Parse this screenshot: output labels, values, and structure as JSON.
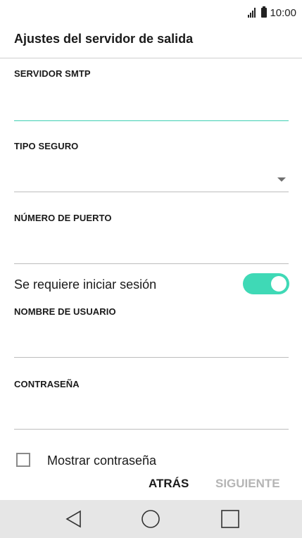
{
  "status_bar": {
    "time": "10:00",
    "signal_icon": "signal-icon",
    "battery_icon": "battery-icon"
  },
  "header": {
    "title": "Ajustes del servidor de salida"
  },
  "form": {
    "smtp_server": {
      "label": "SERVIDOR SMTP",
      "value": ""
    },
    "security_type": {
      "label": "TIPO SEGURO",
      "value": "",
      "icon": "dropdown-arrow-icon"
    },
    "port": {
      "label": "NÚMERO DE PUERTO",
      "value": ""
    },
    "login_required": {
      "label": "Se requiere iniciar sesión",
      "enabled": true,
      "accent_color": "#3fd9b6"
    },
    "username": {
      "label": "NOMBRE DE USUARIO",
      "value": ""
    },
    "password": {
      "label": "CONTRASEÑA",
      "value": ""
    },
    "show_password": {
      "label": "Mostrar contraseña",
      "checked": false
    }
  },
  "actions": {
    "back_label": "ATRÁS",
    "next_label": "SIGUIENTE",
    "next_disabled": true
  },
  "nav_bar": {
    "back_icon": "back-triangle-icon",
    "home_icon": "home-circle-icon",
    "recents_icon": "recents-square-icon"
  }
}
